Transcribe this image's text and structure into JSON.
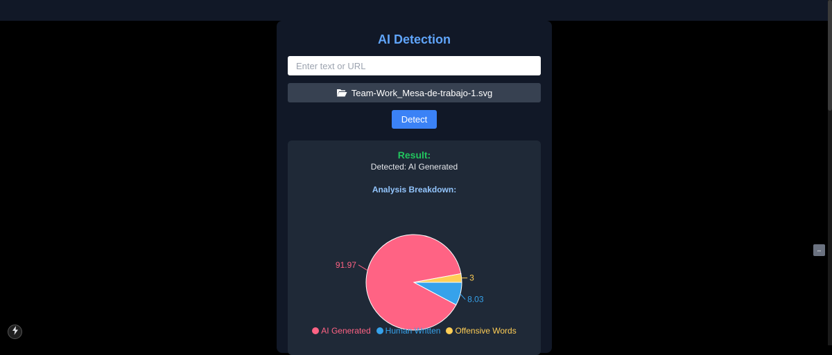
{
  "app": {
    "title": "AI Detection"
  },
  "input": {
    "placeholder": "Enter text or URL",
    "value": ""
  },
  "file": {
    "name": "Team-Work_Mesa-de-trabajo-1.svg",
    "icon": "folder-open-icon"
  },
  "detect_button": {
    "label": "Detect"
  },
  "result": {
    "title": "Result:",
    "detected": "Detected: AI Generated",
    "breakdown_title": "Analysis Breakdown:"
  },
  "chart_data": {
    "type": "pie",
    "categories": [
      "AI Generated",
      "Human Written",
      "Offensive Words"
    ],
    "values": [
      91.97,
      8.03,
      3
    ],
    "colors": [
      "#ff6384",
      "#36a2eb",
      "#ffce56"
    ],
    "data_labels": [
      "91.97",
      "8.03",
      "3"
    ],
    "legend_position": "bottom"
  },
  "colors": {
    "accent": "#3b82f6",
    "title": "#60a5fa",
    "result": "#22c55e"
  }
}
